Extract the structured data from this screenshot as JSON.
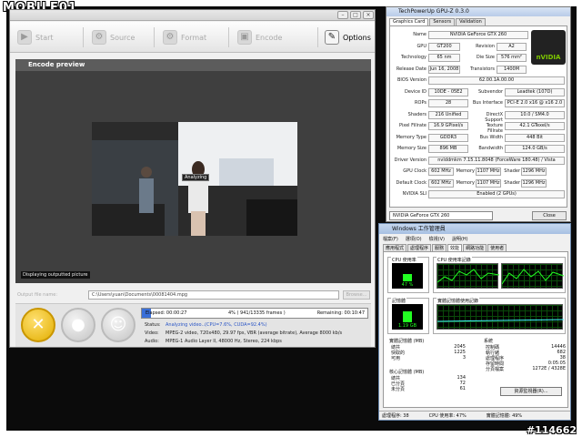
{
  "watermark": {
    "logo": "MOBILE01",
    "id": "#114662"
  },
  "encoder": {
    "toolbar": {
      "start": "Start",
      "source": "Source",
      "format": "Format",
      "encode": "Encode",
      "options": "Options"
    },
    "preview_title": "Encode preview",
    "overlay_status": "Analyzing",
    "displaying": "Displaying outputted picture",
    "output_label": "Output file name:",
    "output_path": "C:\\Users\\yuan\\Documents\\00081404.mpg",
    "browse": "Browse...",
    "progress": {
      "elapsed": "Elapsed: 00:00:27",
      "frames": "4% ( 941/13335 frames )",
      "remaining": "Remaining: 00:10:47",
      "fraction": 0.04
    },
    "status_label": "Status:",
    "status": "Analyzing video...",
    "usage": "(CPU=7.6%, CUDA=92.4%)",
    "video_label": "Video:",
    "video": "MPEG-2 video, 720x480, 29.97 fps, VBR (average bitrate), Average 8000 kb/s",
    "audio_label": "Audio:",
    "audio": "MPEG-1 Audio Layer II, 48000 Hz, Stereo, 224 kbps"
  },
  "gpuz": {
    "title": "TechPowerUp GPU-Z 0.3.0",
    "tabs": [
      "Graphics Card",
      "Sensors",
      "Validation"
    ],
    "rows": [
      {
        "l": "Name",
        "v": "NVIDIA GeForce GTX 260"
      },
      {
        "l": "GPU",
        "v": "GT200",
        "l2": "Revision",
        "v2": "A2"
      },
      {
        "l": "Technology",
        "v": "65 nm",
        "l2": "Die Size",
        "v2": "576 mm²"
      },
      {
        "l": "Release Date",
        "v": "Jun 16, 2008",
        "l2": "Transistors",
        "v2": "1400M"
      },
      {
        "l": "BIOS Version",
        "v": "62.00.1A.00.00"
      },
      {
        "l": "Device ID",
        "v": "10DE - 05E2",
        "l2": "Subvendor",
        "v2": "Leadtek (107D)"
      },
      {
        "l": "ROPs",
        "v": "28",
        "l2": "Bus Interface",
        "v2": "PCI-E 2.0 x16 @ x16 2.0"
      },
      {
        "l": "Shaders",
        "v": "216 Unified",
        "l2": "DirectX Support",
        "v2": "10.0 / SM4.0"
      },
      {
        "l": "Pixel Fillrate",
        "v": "16.9 GPixel/s",
        "l2": "Texture Fillrate",
        "v2": "42.1 GTexel/s"
      },
      {
        "l": "Memory Type",
        "v": "GDDR3",
        "l2": "Bus Width",
        "v2": "448 Bit"
      },
      {
        "l": "Memory Size",
        "v": "896 MB",
        "l2": "Bandwidth",
        "v2": "124.0 GB/s"
      },
      {
        "l": "Driver Version",
        "v": "nvlddmkm 7.15.11.8048 (ForceWare 180.48) / Vista"
      },
      {
        "l": "GPU Clock",
        "v": "602 MHz",
        "l2": "Memory",
        "v2": "1107 MHz",
        "l3": "Shader",
        "v3": "1296 MHz"
      },
      {
        "l": "Default Clock",
        "v": "602 MHz",
        "l2": "Memory",
        "v2": "1107 MHz",
        "l3": "Shader",
        "v3": "1296 MHz"
      },
      {
        "l": "NVIDIA SLI",
        "v": "Enabled (2 GPUs)"
      }
    ],
    "logo": "nVIDIA",
    "selected": "NVIDIA GeForce GTX 260",
    "close": "Close"
  },
  "taskmgr": {
    "title": "Windows 工作管理員",
    "menu": [
      "檔案(F)",
      "選項(O)",
      "檢視(V)",
      "說明(H)"
    ],
    "tabs": [
      "應用程式",
      "處理程序",
      "服務",
      "效能",
      "網路功能",
      "使用者"
    ],
    "cpu_usage_label": "CPU 使用率",
    "cpu_usage": "47 %",
    "cpu_history_label": "CPU 使用率記錄",
    "mem_label": "記憶體",
    "mem_value": "1.19 GB",
    "mem_history_label": "實體記憶體使用記錄",
    "phys": {
      "title": "實體記憶體 (MB)",
      "rows": [
        [
          "總共",
          "2045"
        ],
        [
          "快取的",
          "1225"
        ],
        [
          "可用",
          "3"
        ]
      ]
    },
    "kernel": {
      "title": "核心記憶體 (MB)",
      "rows": [
        [
          "總共",
          "134"
        ],
        [
          "已分頁",
          "72"
        ],
        [
          "未分頁",
          "61"
        ]
      ]
    },
    "system": {
      "title": "系統",
      "rows": [
        [
          "控制碼",
          "14446"
        ],
        [
          "執行緒",
          "682"
        ],
        [
          "處理程序",
          "38"
        ],
        [
          "存留時間",
          "0:05:05"
        ],
        [
          "分頁檔案",
          "1272E / 4328E"
        ]
      ]
    },
    "resmon": "資源監視器(R)...",
    "status": {
      "procs": "處理程序: 38",
      "cpu": "CPU 使用率: 47%",
      "mem": "實體記憶體: 49%"
    }
  }
}
